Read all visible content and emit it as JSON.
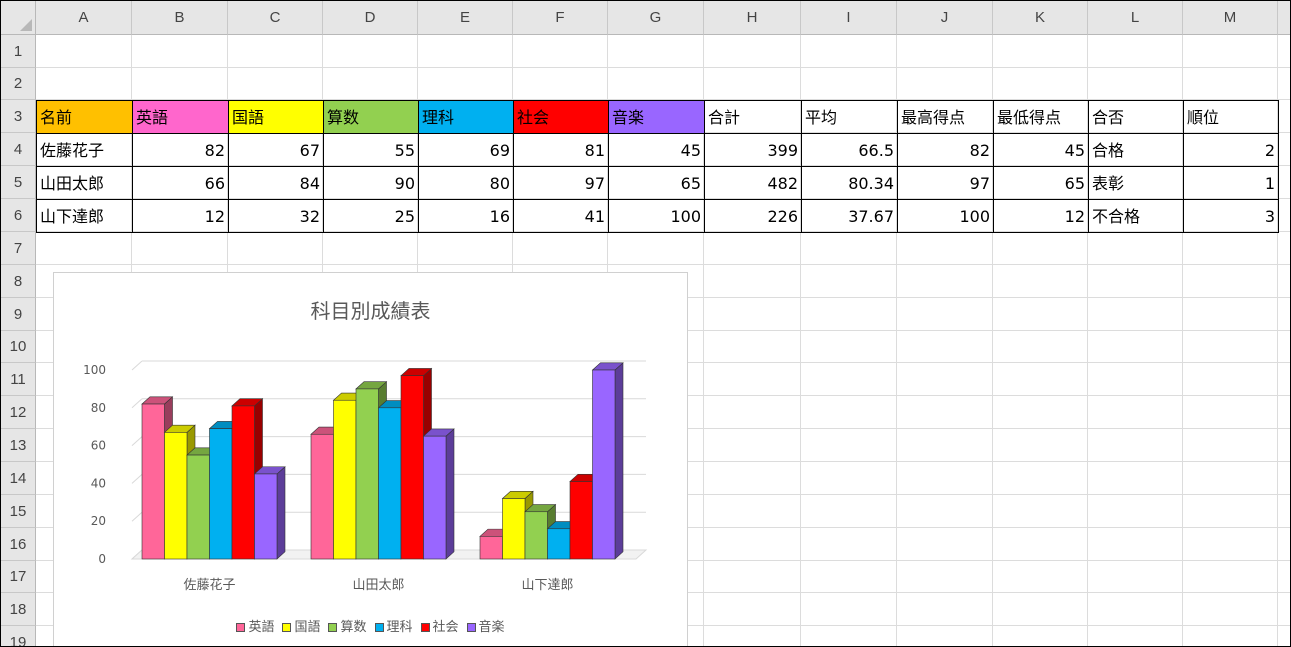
{
  "columns": [
    "A",
    "B",
    "C",
    "D",
    "E",
    "F",
    "G",
    "H",
    "I",
    "J",
    "K",
    "L",
    "M"
  ],
  "rows": [
    "1",
    "2",
    "3",
    "4",
    "5",
    "6",
    "7",
    "8",
    "9",
    "10",
    "11",
    "12",
    "13",
    "14",
    "15",
    "16",
    "17",
    "18",
    "19"
  ],
  "table": {
    "headers": [
      {
        "label": "名前",
        "color": "#ffc000"
      },
      {
        "label": "英語",
        "color": "#ff66cc"
      },
      {
        "label": "国語",
        "color": "#ffff00"
      },
      {
        "label": "算数",
        "color": "#92d050"
      },
      {
        "label": "理科",
        "color": "#00b0f0"
      },
      {
        "label": "社会",
        "color": "#ff0000"
      },
      {
        "label": "音楽",
        "color": "#9966ff"
      },
      {
        "label": "合計",
        "color": ""
      },
      {
        "label": "平均",
        "color": ""
      },
      {
        "label": "最高得点",
        "color": ""
      },
      {
        "label": "最低得点",
        "color": ""
      },
      {
        "label": "合否",
        "color": ""
      },
      {
        "label": "順位",
        "color": ""
      }
    ],
    "rows": [
      [
        "佐藤花子",
        "82",
        "67",
        "55",
        "69",
        "81",
        "45",
        "399",
        "66.5",
        "82",
        "45",
        "合格",
        "2"
      ],
      [
        "山田太郎",
        "66",
        "84",
        "90",
        "80",
        "97",
        "65",
        "482",
        "80.34",
        "97",
        "65",
        "表彰",
        "1"
      ],
      [
        "山下達郎",
        "12",
        "32",
        "25",
        "16",
        "41",
        "100",
        "226",
        "37.67",
        "100",
        "12",
        "不合格",
        "3"
      ]
    ]
  },
  "chart_data": {
    "type": "bar",
    "title": "科目別成績表",
    "categories": [
      "佐藤花子",
      "山田太郎",
      "山下達郎"
    ],
    "series": [
      {
        "name": "英語",
        "values": [
          82,
          66,
          12
        ],
        "color": "#ff6699"
      },
      {
        "name": "国語",
        "values": [
          67,
          84,
          32
        ],
        "color": "#ffff00"
      },
      {
        "name": "算数",
        "values": [
          55,
          90,
          25
        ],
        "color": "#92d050"
      },
      {
        "name": "理科",
        "values": [
          69,
          80,
          16
        ],
        "color": "#00b0f0"
      },
      {
        "name": "社会",
        "values": [
          81,
          97,
          41
        ],
        "color": "#ff0000"
      },
      {
        "name": "音楽",
        "values": [
          45,
          65,
          100
        ],
        "color": "#9966ff"
      }
    ],
    "ylim": [
      0,
      100
    ],
    "yticks": [
      "0",
      "20",
      "40",
      "60",
      "80",
      "100"
    ],
    "grid": true,
    "legend": "bottom",
    "style": "3d-clustered-column"
  }
}
